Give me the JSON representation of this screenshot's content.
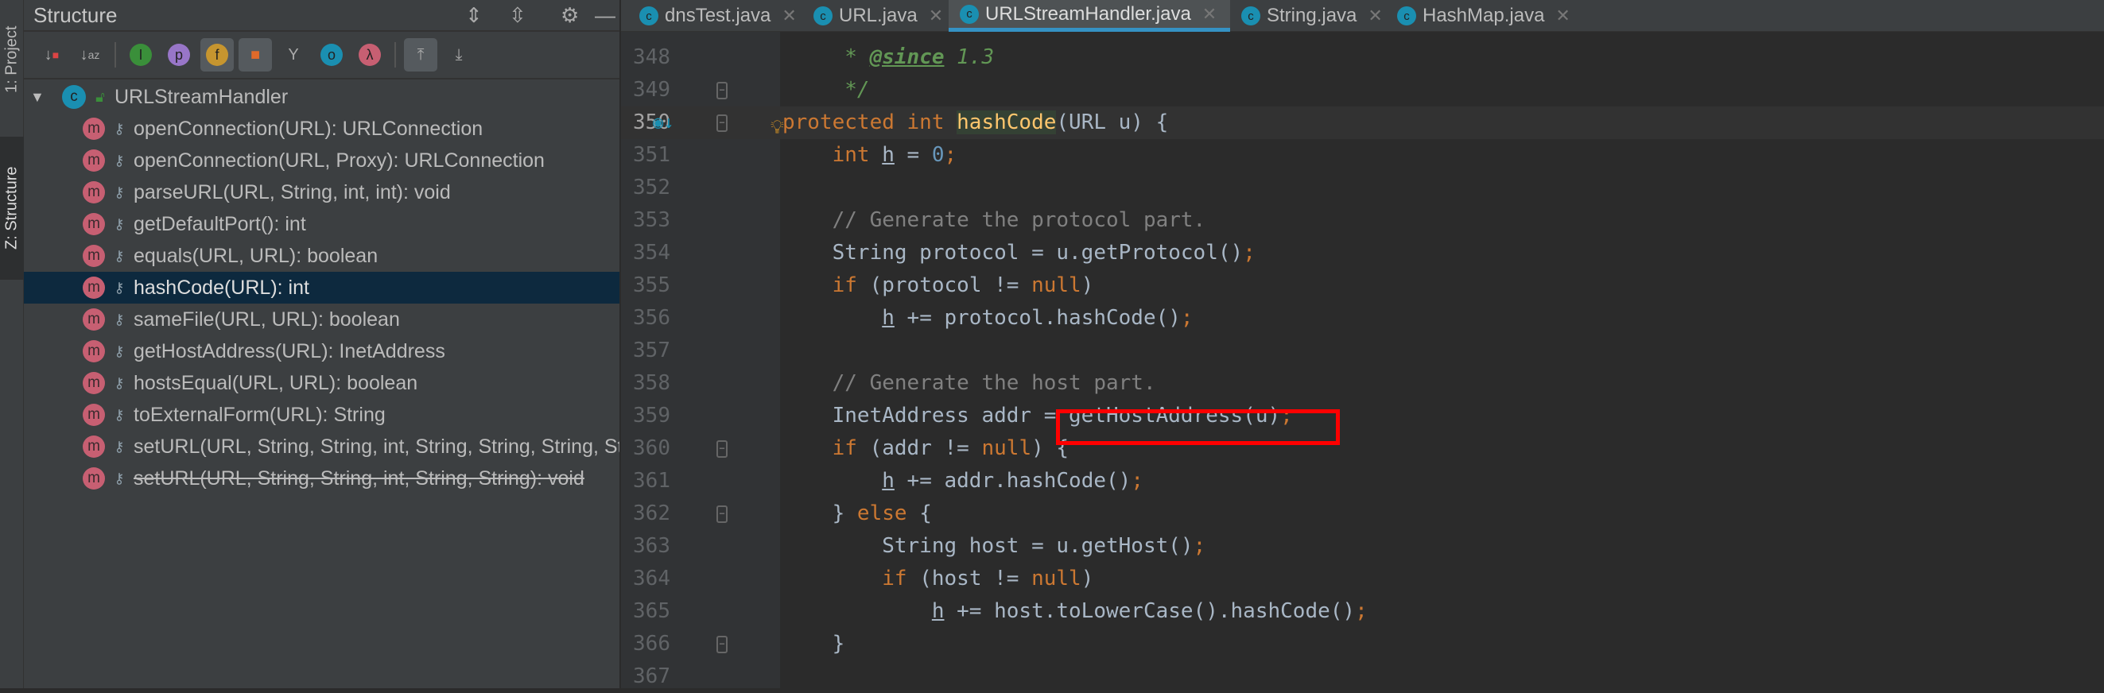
{
  "side_tabs": {
    "project": "1: Project",
    "structure": "Z: Structure"
  },
  "panel": {
    "title": "Structure",
    "toolbar": [
      "sort-by-visibility",
      "sort-alphabetically",
      "show-inherited",
      "show-properties",
      "show-fields",
      "show-non-public",
      "show-anonymous",
      "show-lambdas",
      "expand",
      "autoscroll-to-source",
      "autoscroll-from-source"
    ],
    "root": "URLStreamHandler",
    "items": [
      {
        "label": "openConnection(URL): URLConnection",
        "icon": "m",
        "abstract": true
      },
      {
        "label": "openConnection(URL, Proxy): URLConnection",
        "icon": "m"
      },
      {
        "label": "parseURL(URL, String, int, int): void",
        "icon": "m"
      },
      {
        "label": "getDefaultPort(): int",
        "icon": "m"
      },
      {
        "label": "equals(URL, URL): boolean",
        "icon": "m"
      },
      {
        "label": "hashCode(URL): int",
        "icon": "m",
        "selected": true
      },
      {
        "label": "sameFile(URL, URL): boolean",
        "icon": "m"
      },
      {
        "label": "getHostAddress(URL): InetAddress",
        "icon": "m"
      },
      {
        "label": "hostsEqual(URL, URL): boolean",
        "icon": "m"
      },
      {
        "label": "toExternalForm(URL): String",
        "icon": "m"
      },
      {
        "label": "setURL(URL, String, String, int, String, String, String, String, String): void",
        "icon": "m"
      },
      {
        "label": "setURL(URL, String, String, int, String, String): void",
        "icon": "m",
        "deprecated": true
      }
    ]
  },
  "tabs": [
    {
      "label": "dnsTest.java"
    },
    {
      "label": "URL.java"
    },
    {
      "label": "URLStreamHandler.java",
      "active": true
    },
    {
      "label": "String.java"
    },
    {
      "label": "HashMap.java"
    }
  ],
  "code": [
    {
      "n": "348",
      "t": [
        [
          "     * ",
          "jd"
        ],
        [
          "@since",
          "jt"
        ],
        [
          " 1.3",
          "jd"
        ]
      ]
    },
    {
      "n": "349",
      "t": [
        [
          "     */",
          "jd"
        ]
      ]
    },
    {
      "n": "350",
      "cur": true,
      "t": [
        [
          "protected int ",
          "kw"
        ],
        [
          "hashCode",
          "md"
        ],
        [
          "(URL u) {",
          ""
        ]
      ]
    },
    {
      "n": "351",
      "t": [
        [
          "    ",
          ""
        ],
        [
          "int ",
          "kw"
        ],
        [
          "h",
          "ul"
        ],
        [
          " = ",
          ""
        ],
        [
          "0",
          "nm"
        ],
        [
          ";",
          "kw"
        ]
      ]
    },
    {
      "n": "352",
      "t": []
    },
    {
      "n": "353",
      "t": [
        [
          "    // Generate the protocol part.",
          "cm"
        ]
      ]
    },
    {
      "n": "354",
      "t": [
        [
          "    String protocol = u.getProtocol()",
          ""
        ],
        [
          ";",
          "kw"
        ]
      ]
    },
    {
      "n": "355",
      "t": [
        [
          "    ",
          ""
        ],
        [
          "if ",
          "kw"
        ],
        [
          "(protocol != ",
          ""
        ],
        [
          "null",
          "kw"
        ],
        [
          ")",
          ""
        ]
      ]
    },
    {
      "n": "356",
      "t": [
        [
          "        ",
          ""
        ],
        [
          "h",
          "ul"
        ],
        [
          " += protocol.hashCode()",
          ""
        ],
        [
          ";",
          "kw"
        ]
      ]
    },
    {
      "n": "357",
      "t": []
    },
    {
      "n": "358",
      "t": [
        [
          "    // Generate the host part.",
          "cm"
        ]
      ]
    },
    {
      "n": "359",
      "t": [
        [
          "    InetAddress addr = getHostAddress(u)",
          ""
        ],
        [
          ";",
          "kw"
        ]
      ]
    },
    {
      "n": "360",
      "t": [
        [
          "    ",
          ""
        ],
        [
          "if ",
          "kw"
        ],
        [
          "(addr != ",
          ""
        ],
        [
          "null",
          "kw"
        ],
        [
          ") {",
          ""
        ]
      ]
    },
    {
      "n": "361",
      "t": [
        [
          "        ",
          ""
        ],
        [
          "h",
          "ul"
        ],
        [
          " += addr.hashCode()",
          ""
        ],
        [
          ";",
          "kw"
        ]
      ]
    },
    {
      "n": "362",
      "t": [
        [
          "    } ",
          ""
        ],
        [
          "else ",
          "kw"
        ],
        [
          "{",
          ""
        ]
      ]
    },
    {
      "n": "363",
      "t": [
        [
          "        String host = u.getHost()",
          ""
        ],
        [
          ";",
          "kw"
        ]
      ]
    },
    {
      "n": "364",
      "t": [
        [
          "        ",
          ""
        ],
        [
          "if ",
          "kw"
        ],
        [
          "(host != ",
          ""
        ],
        [
          "null",
          "kw"
        ],
        [
          ")",
          ""
        ]
      ]
    },
    {
      "n": "365",
      "t": [
        [
          "            ",
          ""
        ],
        [
          "h",
          "ul"
        ],
        [
          " += host.toLowerCase().hashCode()",
          ""
        ],
        [
          ";",
          "kw"
        ]
      ]
    },
    {
      "n": "366",
      "t": [
        [
          "    }",
          ""
        ]
      ]
    },
    {
      "n": "367",
      "t": []
    }
  ],
  "highlight_color": "#ff0000"
}
